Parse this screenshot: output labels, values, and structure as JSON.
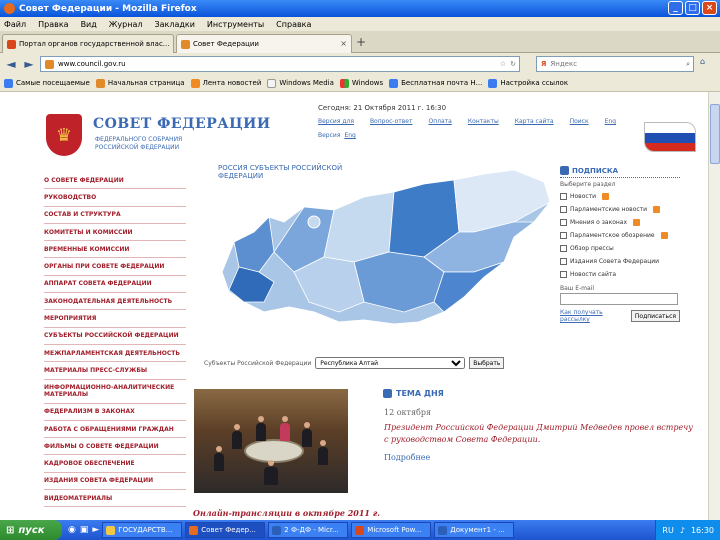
{
  "window": {
    "title": "Совет Федерации - Mozilla Firefox"
  },
  "menu": [
    "Файл",
    "Правка",
    "Вид",
    "Журнал",
    "Закладки",
    "Инструменты",
    "Справка"
  ],
  "tabs": [
    {
      "label": "Портал органов государственной влас...",
      "favicon_color": "#d9481a"
    },
    {
      "label": "Совет Федерации",
      "favicon_color": "#e28a2a"
    }
  ],
  "nav": {
    "url": "www.council.gov.ru",
    "search_placeholder": "Яндекс"
  },
  "bookmarks": [
    "Самые посещаемые",
    "Начальная страница",
    "Лента новостей",
    "Windows Media",
    "Windows",
    "Бесплатная почта Н...",
    "Настройка ссылок"
  ],
  "page": {
    "title": "СОВЕТ ФЕДЕРАЦИИ",
    "subtitle": "ФЕДЕРАЛЬНОГО СОБРАНИЯ РОССИЙСКОЙ ФЕДЕРАЦИИ",
    "date": "Сегодня: 21 Октября 2011 г. 16:30",
    "top_links": [
      "Версия для",
      "Вопрос-ответ",
      "Оплата",
      "Контакты",
      "Карта сайта",
      "Поиск",
      "Eng"
    ],
    "top_links2": [
      "Версия",
      "Eng"
    ],
    "map_label": "РОССИЯ СУБЪЕКТЫ РОССИЙСКОЙ ФЕДЕРАЦИИ",
    "left_menu": [
      "О совете федерации",
      "Руководство",
      "Состав и структура",
      "Комитеты и комиссии",
      "Временные комиссии",
      "Органы при совете федерации",
      "Аппарат совета федерации",
      "Законодательная деятельность",
      "Мероприятия",
      "Субъекты российской федерации",
      "Межпарламентская деятельность",
      "Материалы пресс-службы",
      "Информационно-аналитические материалы",
      "Федерализм в законах",
      "Работа с обращениями граждан",
      "Фильмы о совете федерации",
      "Кадровое обеспечение",
      "Издания совета федерации",
      "Видеоматериалы"
    ],
    "regions": {
      "label": "Субъекты Российской Федерации",
      "selected": "Республика Алтай",
      "button": "Выбрать"
    },
    "subscribe": {
      "title": "Подписка",
      "hint": "Выберите раздел",
      "items": [
        "Новости",
        "Парламентские новости",
        "Мнения о законах",
        "Парламентское обозрение",
        "Обзор прессы",
        "Издания Совета Федерации",
        "Новости сайта"
      ],
      "email_label": "Ваш E-mail",
      "help_link": "Как получать рассылку",
      "button": "Подписаться"
    },
    "photo_caption": "Онлайн-трансляции в октябре 2011 г.",
    "day_theme": {
      "title": "Тема дня",
      "date": "12 октября",
      "text": "Президент Российской Федерации Дмитрий Медведев провел встречу с руководством Совета Федерации.",
      "more": "Подробнее"
    }
  },
  "taskbar": {
    "start": "пуск",
    "items": [
      "ГОСУДАРСТВ...",
      "Совет Федер...",
      "2 Ф-ДФ - Micr...",
      "Microsoft Pow...",
      "Документ1 - ..."
    ],
    "lang": "RU",
    "time": "16:30"
  },
  "colors": {
    "brand_blue": "#3a6ab3",
    "menu_red": "#a01e2a",
    "flag": [
      "#ffffff",
      "#1f4fb3",
      "#d52b1e"
    ]
  }
}
